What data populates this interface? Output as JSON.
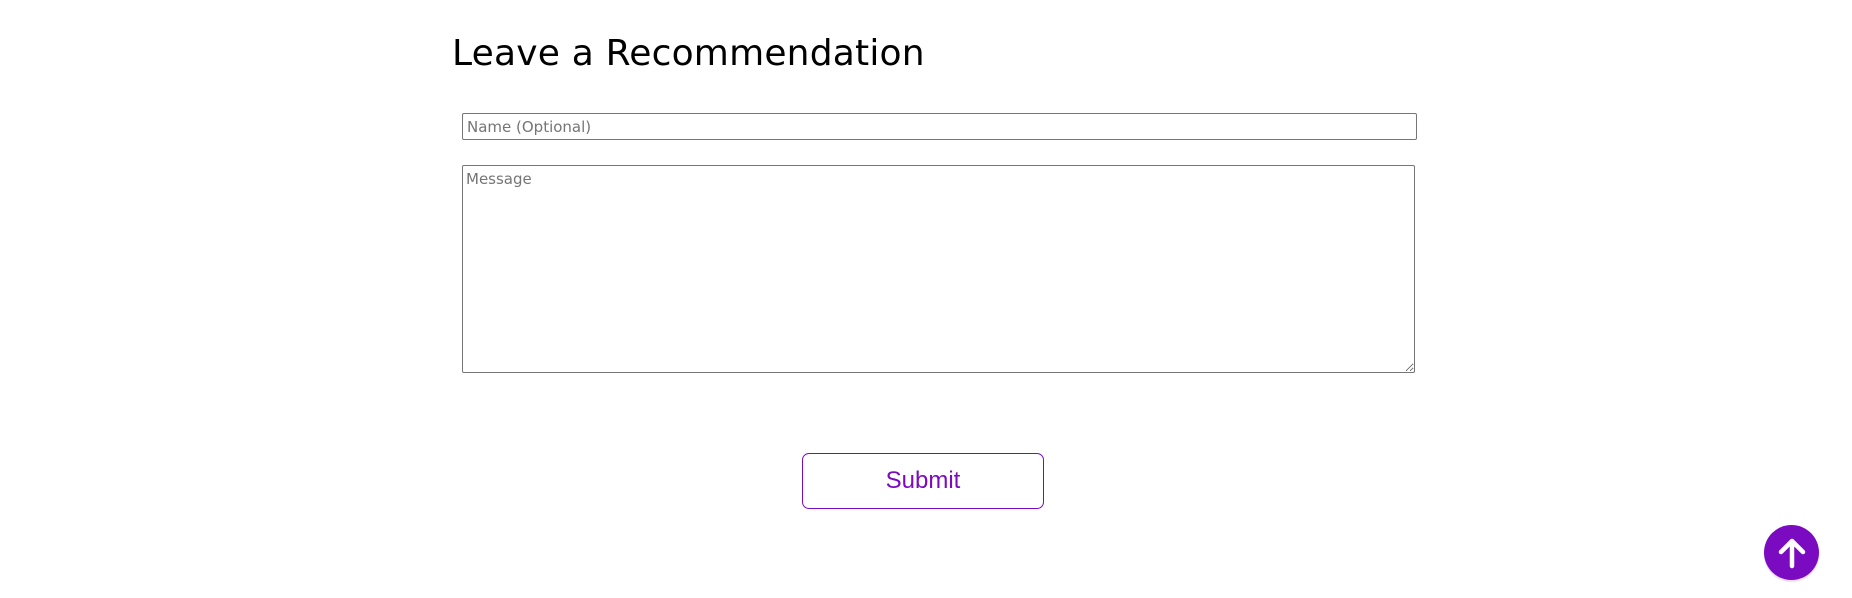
{
  "form": {
    "heading": "Leave a Recommendation",
    "name_placeholder": "Name (Optional)",
    "name_value": "",
    "message_placeholder": "Message",
    "message_value": "",
    "submit_label": "Submit"
  },
  "scroll_top": {
    "icon": "arrow-up-icon"
  },
  "colors": {
    "accent": "#7a0bc0",
    "border": "#767676",
    "placeholder": "#757575",
    "heading": "#000000",
    "background": "#ffffff"
  }
}
